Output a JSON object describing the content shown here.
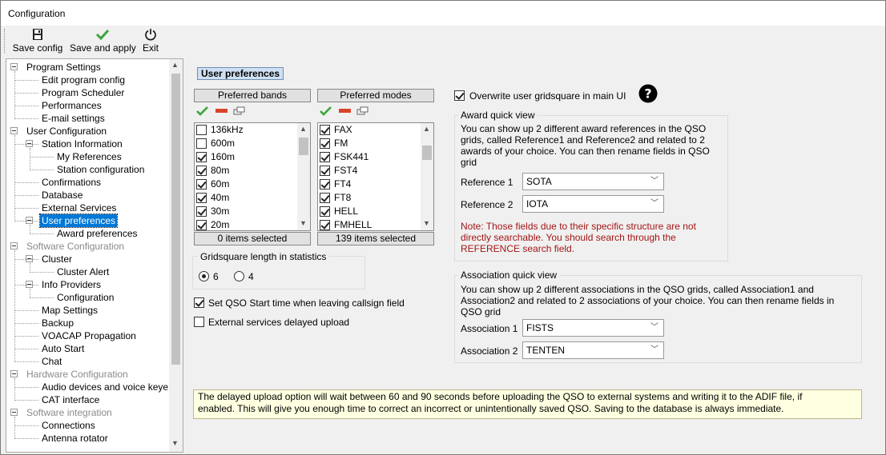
{
  "window": {
    "title": "Configuration"
  },
  "toolbar": {
    "save_config": "Save config",
    "save_apply": "Save and apply",
    "exit": "Exit"
  },
  "tree": {
    "items": [
      {
        "label": "Program Settings",
        "level": 0,
        "disabled": false
      },
      {
        "label": "Edit program config",
        "level": 1,
        "disabled": false
      },
      {
        "label": "Program Scheduler",
        "level": 1,
        "disabled": false
      },
      {
        "label": "Performances",
        "level": 1,
        "disabled": false
      },
      {
        "label": "E-mail settings",
        "level": 1,
        "disabled": false
      },
      {
        "label": "User Configuration",
        "level": 0,
        "disabled": false
      },
      {
        "label": "Station Information",
        "level": 1,
        "disabled": false
      },
      {
        "label": "My References",
        "level": 2,
        "disabled": false
      },
      {
        "label": "Station configuration",
        "level": 2,
        "disabled": false
      },
      {
        "label": "Confirmations",
        "level": 1,
        "disabled": false
      },
      {
        "label": "Database",
        "level": 1,
        "disabled": false
      },
      {
        "label": "External Services",
        "level": 1,
        "disabled": false
      },
      {
        "label": "User preferences",
        "level": 1,
        "disabled": false,
        "selected": true
      },
      {
        "label": "Award preferences",
        "level": 2,
        "disabled": false
      },
      {
        "label": "Software Configuration",
        "level": 0,
        "disabled": true
      },
      {
        "label": "Cluster",
        "level": 1,
        "disabled": false
      },
      {
        "label": "Cluster Alert",
        "level": 2,
        "disabled": false
      },
      {
        "label": "Info Providers",
        "level": 1,
        "disabled": false
      },
      {
        "label": "Configuration",
        "level": 2,
        "disabled": false
      },
      {
        "label": "Map Settings",
        "level": 1,
        "disabled": false
      },
      {
        "label": "Backup",
        "level": 1,
        "disabled": false
      },
      {
        "label": "VOACAP Propagation",
        "level": 1,
        "disabled": false
      },
      {
        "label": "Auto Start",
        "level": 1,
        "disabled": false
      },
      {
        "label": "Chat",
        "level": 1,
        "disabled": false
      },
      {
        "label": "Hardware Configuration",
        "level": 0,
        "disabled": true
      },
      {
        "label": "Audio devices and voice keye",
        "level": 1,
        "disabled": false
      },
      {
        "label": "CAT interface",
        "level": 1,
        "disabled": false
      },
      {
        "label": "Software integration",
        "level": 0,
        "disabled": true
      },
      {
        "label": "Connections",
        "level": 1,
        "disabled": false
      },
      {
        "label": "Antenna rotator",
        "level": 1,
        "disabled": false
      }
    ]
  },
  "main": {
    "heading": "User preferences",
    "bands": {
      "header": "Preferred bands",
      "items": [
        {
          "label": "136kHz",
          "checked": false
        },
        {
          "label": "600m",
          "checked": false
        },
        {
          "label": "160m",
          "checked": true
        },
        {
          "label": "80m",
          "checked": true
        },
        {
          "label": "60m",
          "checked": true
        },
        {
          "label": "40m",
          "checked": true
        },
        {
          "label": "30m",
          "checked": true
        },
        {
          "label": "20m",
          "checked": true
        }
      ],
      "footer": "0 items selected"
    },
    "modes": {
      "header": "Preferred modes",
      "items": [
        {
          "label": "FAX",
          "checked": true
        },
        {
          "label": "FM",
          "checked": true
        },
        {
          "label": "FSK441",
          "checked": true
        },
        {
          "label": "FST4",
          "checked": true
        },
        {
          "label": "FT4",
          "checked": true
        },
        {
          "label": "FT8",
          "checked": true
        },
        {
          "label": "HELL",
          "checked": true
        },
        {
          "label": "FMHELL",
          "checked": true
        }
      ],
      "footer": "139 items selected"
    },
    "gridsquare": {
      "title": "Gridsquare length in statistics",
      "option6": "6",
      "option4": "4"
    },
    "set_qso_start": "Set QSO Start time when leaving callsign field",
    "ext_delayed": "External services delayed upload",
    "overwrite_grid": "Overwrite user gridsquare in main UI",
    "award": {
      "title": "Award quick view",
      "desc1": "You can show up 2 different award references in the QSO",
      "desc2": "grids, called Reference1 and Reference2 and related to 2",
      "desc3": "awards of your choice. You can then rename fields in QSO",
      "desc4": "grid",
      "ref1_label": "Reference 1",
      "ref1_value": "SOTA",
      "ref2_label": "Reference 2",
      "ref2_value": "IOTA",
      "note1": "Note: Those fields due to their specific structure are not",
      "note2": "directly searchable. You should search through the",
      "note3": "REFERENCE search field."
    },
    "assoc": {
      "title": "Association quick view",
      "desc1": "You can show up 2 different associations in the QSO grids, called Association1 and",
      "desc2": "Association2 and related to 2 associations of your choice. You can then rename fields in",
      "desc3": "QSO grid",
      "a1_label": "Association 1",
      "a1_value": "FISTS",
      "a2_label": "Association 2",
      "a2_value": "TENTEN"
    },
    "info": {
      "line1": "The delayed upload option will wait between 60 and 90 seconds before uploading the QSO to external systems and writing it to the ADIF file, if",
      "line2": "enabled. This will give you enough time to correct an incorrect or unintentionally saved QSO. Saving to the database is always immediate."
    }
  }
}
